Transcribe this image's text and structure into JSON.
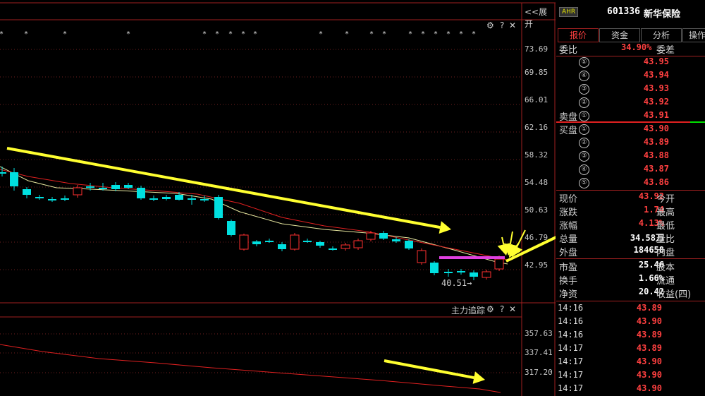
{
  "toolbar": {
    "expand_label": "<<展开"
  },
  "main_chart": {
    "axis_labels": [
      "73.69",
      "69.85",
      "66.01",
      "62.16",
      "58.32",
      "54.48",
      "50.63",
      "46.79",
      "42.95"
    ],
    "low_annotation": "40.51",
    "colors": {
      "up": "#ff3030",
      "down": "#00e0e0",
      "ma_short": "#e8e8a0",
      "ma_long": "#e02020",
      "arrow": "#ffff30",
      "support_line": "#e040e0"
    }
  },
  "sub_chart": {
    "title": "主力追踪",
    "axis_labels": [
      "357.63",
      "337.41",
      "317.20"
    ]
  },
  "controls": {
    "gear": "⚙",
    "help": "?",
    "close": "✕"
  },
  "panel": {
    "badge": "AHR",
    "code": "601336",
    "name": "新华保险",
    "tabs": [
      "报价",
      "资金",
      "分析",
      "操作"
    ],
    "weibi_label": "委比",
    "weibi_value": "34.90%",
    "weicha_label": "委差",
    "sell_label": "卖盘",
    "buy_label": "买盘",
    "sell_levels": [
      {
        "n": "⑤",
        "price": "43.95"
      },
      {
        "n": "④",
        "price": "43.94"
      },
      {
        "n": "③",
        "price": "43.93"
      },
      {
        "n": "②",
        "price": "43.92"
      },
      {
        "n": "①",
        "price": "43.91"
      }
    ],
    "buy_levels": [
      {
        "n": "①",
        "price": "43.90"
      },
      {
        "n": "②",
        "price": "43.89"
      },
      {
        "n": "③",
        "price": "43.88"
      },
      {
        "n": "④",
        "price": "43.87"
      },
      {
        "n": "⑤",
        "price": "43.86"
      }
    ],
    "stats": [
      {
        "label": "现价",
        "value": "43.92",
        "label2": "今开",
        "color": "#ff4040"
      },
      {
        "label": "涨跌",
        "value": "1.74",
        "label2": "最高",
        "color": "#ff4040"
      },
      {
        "label": "涨幅",
        "value": "4.13%",
        "label2": "最低",
        "color": "#ff4040"
      },
      {
        "label": "总量",
        "value": "34.58万",
        "label2": "量比",
        "color": "#ffffff"
      },
      {
        "label": "外盘",
        "value": "184658",
        "label2": "内盘",
        "color": "#ffffff"
      },
      {
        "label": "市盈",
        "value": "25.46",
        "label2": "股本",
        "color": "#ffffff"
      },
      {
        "label": "换手",
        "value": "1.66%",
        "label2": "流通",
        "color": "#ffffff"
      },
      {
        "label": "净资",
        "value": "20.42",
        "label2": "收益(四)",
        "color": "#ffffff"
      }
    ],
    "trades": [
      {
        "time": "14:16",
        "price": "43.89"
      },
      {
        "time": "14:16",
        "price": "43.90"
      },
      {
        "time": "14:16",
        "price": "43.89"
      },
      {
        "time": "14:17",
        "price": "43.89"
      },
      {
        "time": "14:17",
        "price": "43.90"
      },
      {
        "time": "14:17",
        "price": "43.90"
      },
      {
        "time": "14:17",
        "price": "43.90"
      }
    ]
  }
}
